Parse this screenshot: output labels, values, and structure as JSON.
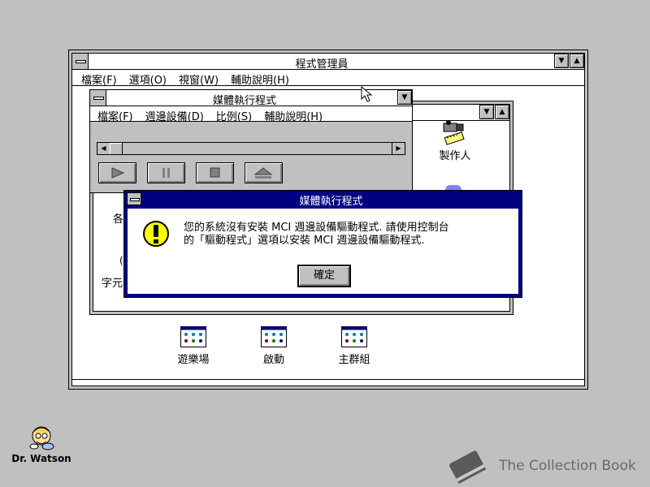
{
  "program_manager": {
    "title": "程式管理員",
    "menu": [
      "檔案(F)",
      "選項(O)",
      "視窗(W)",
      "輔助說明(H)"
    ]
  },
  "media_player": {
    "title": "媒體執行程式",
    "menu": [
      "檔案(F)",
      "週邊設備(D)",
      "比例(S)",
      "輔助說明(H)"
    ]
  },
  "group_window": {
    "icons": [
      "製作人"
    ],
    "partial_labels": [
      "各",
      "字元"
    ]
  },
  "dialog": {
    "title": "媒體執行程式",
    "message_line1": "您的系統沒有安裝 MCI 週邊設備驅動程式. 請使用控制台",
    "message_line2": "的「驅動程式」選項以安裝 MCI 週邊設備驅動程式.",
    "ok_label": "確定"
  },
  "group_icons": [
    "遊樂場",
    "啟動",
    "主群組"
  ],
  "desktop_icons": {
    "dr_watson": "Dr. Watson"
  },
  "watermark": "The Collection Book",
  "colors": {
    "dialog_title": "#000080",
    "desktop": "#c0c0c0",
    "warning_icon": "#ffff00"
  }
}
